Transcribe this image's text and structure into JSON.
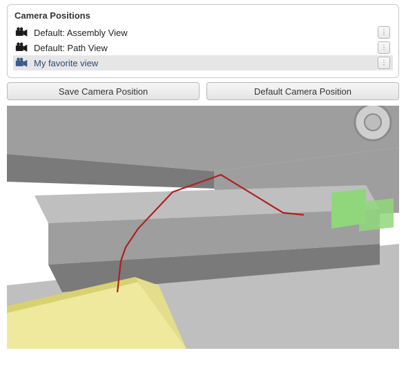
{
  "panel": {
    "title": "Camera Positions",
    "items": [
      {
        "label": "Default: Assembly View",
        "selected": false
      },
      {
        "label": "Default: Path View",
        "selected": false
      },
      {
        "label": "My favorite view",
        "selected": true
      }
    ]
  },
  "buttons": {
    "save": "Save Camera Position",
    "default": "Default Camera Position"
  },
  "menu_glyph": "⋮",
  "scene": {
    "path_color": "#b02020",
    "bin_color": "#efe99d",
    "part_color": "#8fd77a",
    "grey_light": "#bfbfbf",
    "grey_mid": "#9e9e9e",
    "grey_dark": "#7a7a7a"
  }
}
